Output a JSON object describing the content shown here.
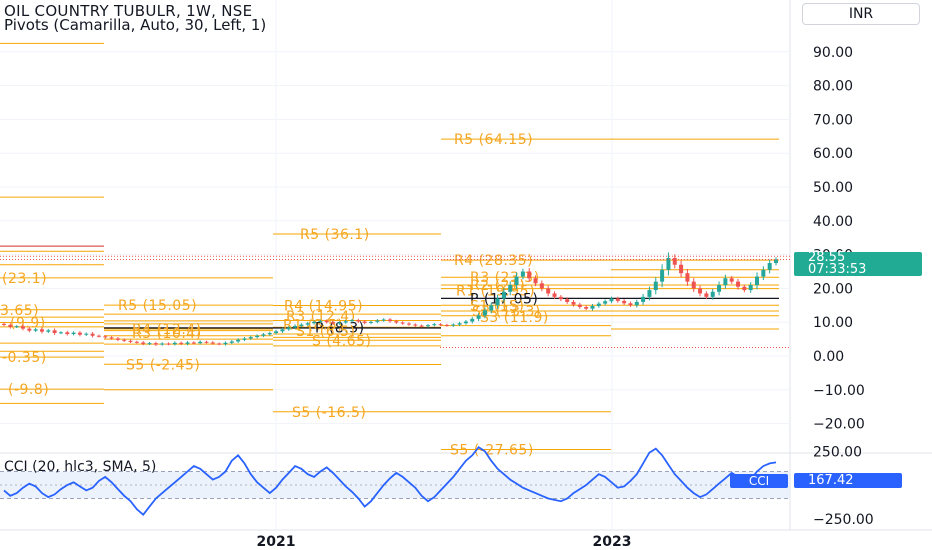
{
  "header": {
    "symbol": "OIL COUNTRY TUBULR, 1W, NSE",
    "indicator": "Pivots (Camarilla, Auto, 30, Left, 1)",
    "currency": "INR"
  },
  "price_badge": {
    "price": "28.55",
    "countdown": "07:33:53"
  },
  "cci_panel": {
    "title": "CCI (20, hlc3, SMA, 5)",
    "tag": "CCI",
    "value": "167.42"
  },
  "colors": {
    "up": "#26a69a",
    "down": "#ef5350",
    "pivot": "#f7a600",
    "pivot_text": "#f5a623",
    "pivot_p": "#131722",
    "cci": "#2962ff",
    "cci_band": "#e3ecfb",
    "grid": "#f0f3fa"
  },
  "chart_data": [
    {
      "type": "candlestick",
      "title": "OIL COUNTRY TUBULR, 1W, NSE",
      "x_ticks": [
        "2021",
        "2023"
      ],
      "y_ticks": [
        "90.00",
        "80.00",
        "70.00",
        "60.00",
        "50.00",
        "40.00",
        "30.00",
        "20.00",
        "10.00",
        "0.00",
        "−10.00",
        "−20.00"
      ],
      "ylim": [
        -27,
        100
      ],
      "last_price": 28.55,
      "price_series": [
        9.2,
        8.6,
        8.8,
        8.1,
        7.5,
        7.9,
        7.2,
        7.6,
        6.8,
        7.0,
        6.5,
        6.9,
        6.3,
        6.6,
        6.0,
        5.8,
        5.5,
        5.2,
        4.8,
        4.5,
        4.2,
        4.0,
        3.6,
        3.8,
        3.4,
        3.7,
        3.5,
        3.9,
        3.6,
        4.0,
        3.8,
        4.2,
        4.0,
        3.7,
        3.5,
        3.9,
        4.3,
        4.8,
        5.2,
        5.6,
        6.0,
        6.4,
        6.8,
        7.3,
        7.9,
        8.4,
        8.9,
        9.3,
        9.7,
        10.1,
        10.4,
        10.0,
        9.6,
        9.9,
        10.3,
        10.6,
        10.2,
        9.8,
        10.1,
        10.5,
        10.8,
        10.3,
        9.9,
        9.6,
        9.3,
        9.0,
        8.8,
        9.1,
        9.4,
        9.2,
        9.0,
        9.3,
        9.7,
        10.2,
        11.0,
        12.0,
        13.5,
        15.0,
        17.0,
        19.0,
        21.0,
        23.5,
        25.0,
        23.0,
        21.5,
        20.0,
        18.5,
        17.5,
        16.8,
        16.0,
        15.2,
        14.5,
        14.0,
        14.8,
        15.5,
        16.2,
        17.0,
        16.3,
        15.6,
        15.0,
        16.0,
        17.5,
        19.5,
        22.0,
        25.5,
        29.0,
        27.0,
        24.5,
        22.0,
        20.0,
        18.5,
        17.5,
        19.0,
        21.0,
        23.0,
        22.0,
        20.5,
        19.5,
        21.0,
        23.5,
        25.5,
        27.5,
        28.55
      ]
    },
    {
      "type": "pivot_levels",
      "labels": [
        {
          "text": "(23.1)"
        },
        {
          "text": "3.65)"
        },
        {
          "text": "(9.9)"
        },
        {
          "text": "-0.35)"
        },
        {
          "text": "(-9.8)"
        },
        {
          "text": "R5 (15.05)"
        },
        {
          "text": "R4 (12.4)"
        },
        {
          "text": "R3 (10.4)"
        },
        {
          "text": "S5 (-2.45)"
        },
        {
          "text": "R5 (36.1)"
        },
        {
          "text": "R4 (14.95)"
        },
        {
          "text": "R3 (12.4)"
        },
        {
          "text": "R1 (8.5)"
        },
        {
          "text": "P (8.3)"
        },
        {
          "text": "S1 (6.5)"
        },
        {
          "text": "S (4.65)"
        },
        {
          "text": "S5 (-16.5)"
        },
        {
          "text": "R5 (64.15)"
        },
        {
          "text": "R4 (28.35)"
        },
        {
          "text": "R3 (23.3)"
        },
        {
          "text": "R2 (21)"
        },
        {
          "text": "R1 (19.95)"
        },
        {
          "text": "P (17.05)"
        },
        {
          "text": "S1 (15)"
        },
        {
          "text": "S2 (13.3)"
        },
        {
          "text": "S3 (11.9)"
        },
        {
          "text": "S5 (-27.65)"
        }
      ]
    },
    {
      "type": "line",
      "title": "CCI (20, hlc3, SMA, 5)",
      "y_ticks": [
        "250.00",
        "−250.00"
      ],
      "ylim": [
        -300,
        300
      ],
      "band": [
        -100,
        100
      ],
      "last_value": 167.42,
      "values": [
        -40,
        -80,
        -60,
        -20,
        10,
        -10,
        -60,
        -90,
        -70,
        -30,
        0,
        20,
        -10,
        -40,
        -20,
        30,
        60,
        20,
        -30,
        -80,
        -120,
        -180,
        -220,
        -160,
        -100,
        -60,
        -20,
        20,
        60,
        100,
        140,
        120,
        80,
        40,
        60,
        100,
        180,
        220,
        160,
        80,
        20,
        -20,
        -60,
        -20,
        40,
        90,
        140,
        120,
        80,
        60,
        100,
        130,
        90,
        40,
        -10,
        -50,
        -100,
        -160,
        -120,
        -60,
        0,
        50,
        90,
        60,
        20,
        -20,
        -80,
        -120,
        -90,
        -40,
        10,
        60,
        120,
        180,
        220,
        280,
        250,
        180,
        120,
        80,
        40,
        10,
        -20,
        -40,
        -60,
        -80,
        -100,
        -110,
        -120,
        -100,
        -60,
        -30,
        0,
        40,
        80,
        60,
        20,
        -20,
        -10,
        30,
        80,
        160,
        240,
        270,
        220,
        150,
        80,
        30,
        -20,
        -60,
        -90,
        -70,
        -30,
        10,
        50,
        90,
        60,
        20,
        40,
        100,
        140,
        160,
        167.42
      ]
    }
  ]
}
